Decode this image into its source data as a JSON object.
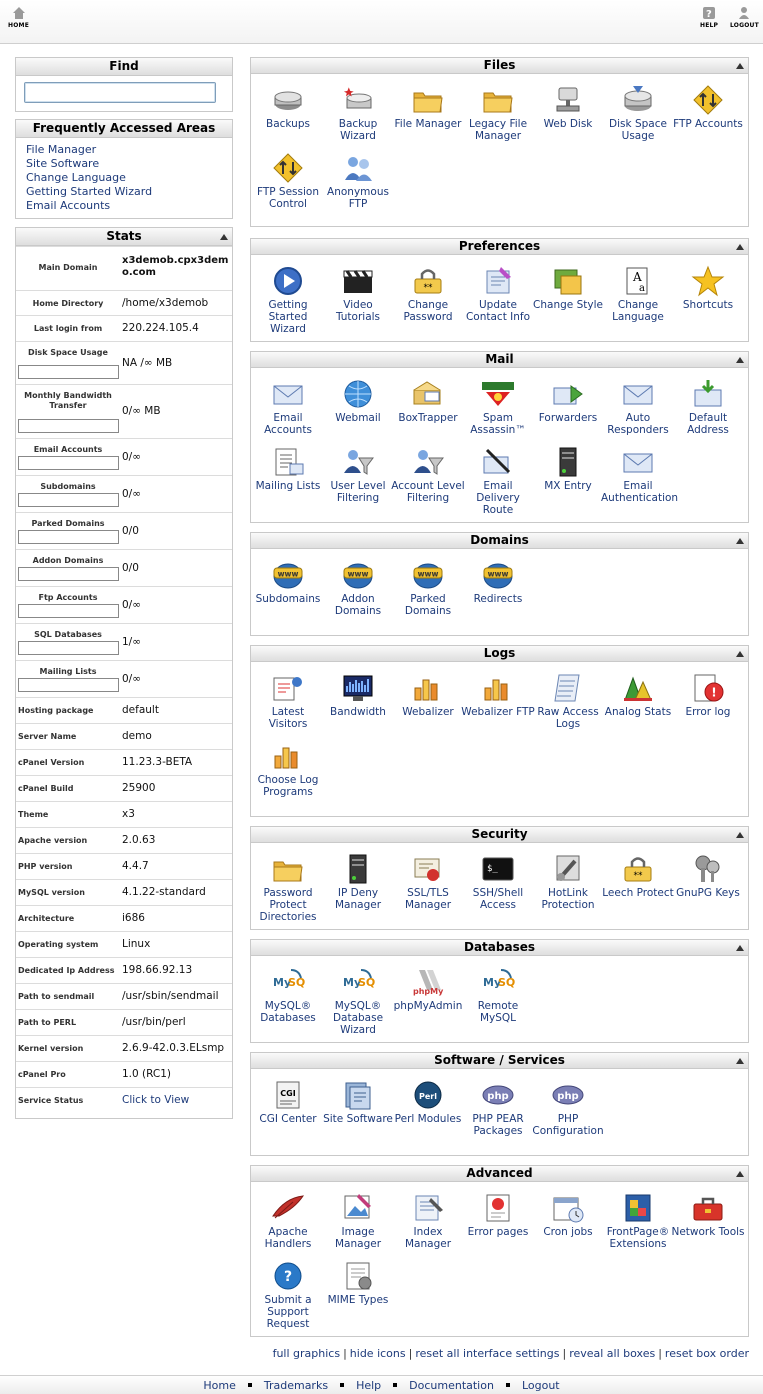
{
  "topbar": {
    "home": "HOME",
    "help": "HELP",
    "logout": "LOGOUT"
  },
  "find": {
    "title": "Find",
    "placeholder": ""
  },
  "faa": {
    "title": "Frequently Accessed Areas",
    "links": [
      "File Manager",
      "Site Software",
      "Change Language",
      "Getting Started Wizard",
      "Email Accounts"
    ]
  },
  "stats": {
    "title": "Stats",
    "rows": [
      {
        "label": "Main Domain",
        "value": "x3demob.cpx3demo.com"
      },
      {
        "label": "Home Directory",
        "value": "/home/x3demob"
      },
      {
        "label": "Last login from",
        "value": "220.224.105.4"
      },
      {
        "label": "Disk Space Usage",
        "value": "NA /∞ MB",
        "usage": 0
      },
      {
        "label": "Monthly Bandwidth Transfer",
        "value": "0/∞ MB",
        "usage": 0
      },
      {
        "label": "Email Accounts",
        "value": "0/∞",
        "usage": 0
      },
      {
        "label": "Subdomains",
        "value": "0/∞",
        "usage": 0
      },
      {
        "label": "Parked Domains",
        "value": "0/0",
        "usage": 0
      },
      {
        "label": "Addon Domains",
        "value": "0/0",
        "usage": 0
      },
      {
        "label": "Ftp Accounts",
        "value": "0/∞",
        "usage": 0
      },
      {
        "label": "SQL Databases",
        "value": "1/∞",
        "usage": 0
      },
      {
        "label": "Mailing Lists",
        "value": "0/∞",
        "usage": 0
      },
      {
        "label": "Hosting package",
        "value": "default"
      },
      {
        "label": "Server Name",
        "value": "demo"
      },
      {
        "label": "cPanel Version",
        "value": "11.23.3-BETA"
      },
      {
        "label": "cPanel Build",
        "value": "25900"
      },
      {
        "label": "Theme",
        "value": "x3"
      },
      {
        "label": "Apache version",
        "value": "2.0.63"
      },
      {
        "label": "PHP version",
        "value": "4.4.7"
      },
      {
        "label": "MySQL version",
        "value": "4.1.22-standard"
      },
      {
        "label": "Architecture",
        "value": "i686"
      },
      {
        "label": "Operating system",
        "value": "Linux"
      },
      {
        "label": "Dedicated Ip Address",
        "value": "198.66.92.13"
      },
      {
        "label": "Path to sendmail",
        "value": "/usr/sbin/sendmail"
      },
      {
        "label": "Path to PERL",
        "value": "/usr/bin/perl"
      },
      {
        "label": "Kernel version",
        "value": "2.6.9-42.0.3.ELsmp"
      },
      {
        "label": "cPanel Pro",
        "value": "1.0 (RC1)"
      },
      {
        "label": "Service Status",
        "value": "Click to View"
      }
    ]
  },
  "panels": [
    {
      "title": "Files",
      "items": [
        {
          "label": "Backups",
          "icon": "backups"
        },
        {
          "label": "Backup Wizard",
          "icon": "backup-wizard"
        },
        {
          "label": "File Manager",
          "icon": "folder"
        },
        {
          "label": "Legacy File Manager",
          "icon": "folder"
        },
        {
          "label": "Web Disk",
          "icon": "web-disk"
        },
        {
          "label": "Disk Space Usage",
          "icon": "disk"
        },
        {
          "label": "FTP Accounts",
          "icon": "ftp"
        },
        {
          "label": "FTP Session Control",
          "icon": "ftp"
        },
        {
          "label": "Anonymous FTP",
          "icon": "users"
        }
      ]
    },
    {
      "title": "Preferences",
      "items": [
        {
          "label": "Getting Started Wizard",
          "icon": "play"
        },
        {
          "label": "Video Tutorials",
          "icon": "clapper"
        },
        {
          "label": "Change Password",
          "icon": "password"
        },
        {
          "label": "Update Contact Info",
          "icon": "contact"
        },
        {
          "label": "Change Style",
          "icon": "style"
        },
        {
          "label": "Change Language",
          "icon": "language"
        },
        {
          "label": "Shortcuts",
          "icon": "star"
        }
      ]
    },
    {
      "title": "Mail",
      "items": [
        {
          "label": "Email Accounts",
          "icon": "envelope"
        },
        {
          "label": "Webmail",
          "icon": "globe"
        },
        {
          "label": "BoxTrapper",
          "icon": "boxtrapper"
        },
        {
          "label": "Spam Assassin™",
          "icon": "spam"
        },
        {
          "label": "Forwarders",
          "icon": "forward"
        },
        {
          "label": "Auto Responders",
          "icon": "envelope"
        },
        {
          "label": "Default Address",
          "icon": "default-address"
        },
        {
          "label": "Mailing Lists",
          "icon": "list"
        },
        {
          "label": "User Level Filtering",
          "icon": "filter"
        },
        {
          "label": "Account Level Filtering",
          "icon": "filter"
        },
        {
          "label": "Email Delivery Route",
          "icon": "route"
        },
        {
          "label": "MX Entry",
          "icon": "server"
        },
        {
          "label": "Email Authentication",
          "icon": "envelope"
        }
      ]
    },
    {
      "title": "Domains",
      "items": [
        {
          "label": "Subdomains",
          "icon": "www"
        },
        {
          "label": "Addon Domains",
          "icon": "www"
        },
        {
          "label": "Parked Domains",
          "icon": "www"
        },
        {
          "label": "Redirects",
          "icon": "www"
        }
      ]
    },
    {
      "title": "Logs",
      "items": [
        {
          "label": "Latest Visitors",
          "icon": "visitors"
        },
        {
          "label": "Bandwidth",
          "icon": "bandwidth"
        },
        {
          "label": "Webalizer",
          "icon": "bars"
        },
        {
          "label": "Webalizer FTP",
          "icon": "bars"
        },
        {
          "label": "Raw Access Logs",
          "icon": "logs"
        },
        {
          "label": "Analog Stats",
          "icon": "analog"
        },
        {
          "label": "Error log",
          "icon": "error"
        },
        {
          "label": "Choose Log Programs",
          "icon": "bars"
        }
      ]
    },
    {
      "title": "Security",
      "items": [
        {
          "label": "Password Protect Directories",
          "icon": "folder"
        },
        {
          "label": "IP Deny Manager",
          "icon": "server"
        },
        {
          "label": "SSL/TLS Manager",
          "icon": "certificate"
        },
        {
          "label": "SSH/Shell Access",
          "icon": "terminal"
        },
        {
          "label": "HotLink Protection",
          "icon": "link"
        },
        {
          "label": "Leech Protect",
          "icon": "password"
        },
        {
          "label": "GnuPG Keys",
          "icon": "keys"
        }
      ]
    },
    {
      "title": "Databases",
      "items": [
        {
          "label": "MySQL® Databases",
          "icon": "mysql"
        },
        {
          "label": "MySQL® Database Wizard",
          "icon": "mysql"
        },
        {
          "label": "phpMyAdmin",
          "icon": "phpmyadmin"
        },
        {
          "label": "Remote MySQL",
          "icon": "mysql"
        }
      ]
    },
    {
      "title": "Software / Services",
      "items": [
        {
          "label": "CGI Center",
          "icon": "cgi"
        },
        {
          "label": "Site Software",
          "icon": "software"
        },
        {
          "label": "Perl Modules",
          "icon": "perl"
        },
        {
          "label": "PHP PEAR Packages",
          "icon": "php"
        },
        {
          "label": "PHP Configuration",
          "icon": "php"
        }
      ]
    },
    {
      "title": "Advanced",
      "items": [
        {
          "label": "Apache Handlers",
          "icon": "feather"
        },
        {
          "label": "Image Manager",
          "icon": "image"
        },
        {
          "label": "Index Manager",
          "icon": "index"
        },
        {
          "label": "Error pages",
          "icon": "error-page"
        },
        {
          "label": "Cron jobs",
          "icon": "calendar"
        },
        {
          "label": "FrontPage® Extensions",
          "icon": "frontpage"
        },
        {
          "label": "Network Tools",
          "icon": "toolbox"
        },
        {
          "label": "Submit a Support Request",
          "icon": "support"
        },
        {
          "label": "MIME Types",
          "icon": "mime"
        }
      ]
    }
  ],
  "bottom_links": [
    "full graphics",
    "hide icons",
    "reset all interface settings",
    "reveal all boxes",
    "reset box order"
  ],
  "footer": [
    "Home",
    "Trademarks",
    "Help",
    "Documentation",
    "Logout"
  ]
}
